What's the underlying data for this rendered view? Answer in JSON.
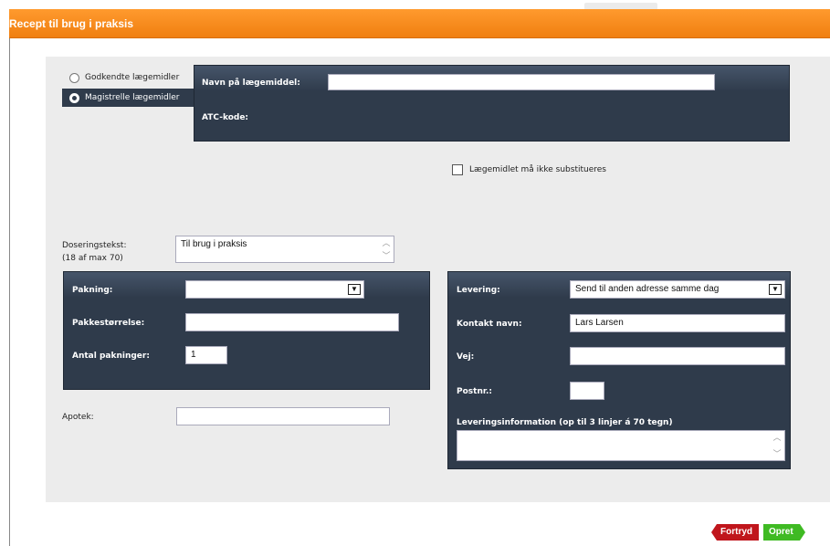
{
  "window": {
    "title": "Recept til brug i praksis"
  },
  "selector": {
    "options": [
      {
        "label": "Godkendte lægemidler",
        "selected": false
      },
      {
        "label": "Magistrelle lægemidler",
        "selected": true
      }
    ]
  },
  "drug_panel": {
    "name_label": "Navn på lægemiddel:",
    "name_value": "",
    "atc_label": "ATC-kode:"
  },
  "substitution": {
    "label": "Lægemidlet må ikke substitueres",
    "checked": false
  },
  "dosage": {
    "label": "Doseringstekst:",
    "count_label": "(18 af max 70)",
    "value": "Til brug i praksis"
  },
  "package_panel": {
    "packaging_label": "Pakning:",
    "packaging_value": "",
    "size_label": "Pakkestørrelse:",
    "size_value": "",
    "count_label": "Antal pakninger:",
    "count_value": "1"
  },
  "pharmacy": {
    "label": "Apotek:",
    "value": ""
  },
  "delivery_panel": {
    "delivery_label": "Levering:",
    "delivery_value": "Send til anden adresse samme dag",
    "contact_label": "Kontakt navn:",
    "contact_value": "Lars Larsen",
    "road_label": "Vej:",
    "road_value": "",
    "zip_label": "Postnr.:",
    "zip_value": "",
    "info_label": "Leveringsinformation (op til 3 linjer á 70 tegn)",
    "info_value": ""
  },
  "actions": {
    "cancel_label": "Fortryd",
    "create_label": "Opret"
  },
  "colors": {
    "header": "#f07f10",
    "panel": "#2f3b4b",
    "cancel": "#c0161c",
    "create": "#3fba23"
  }
}
